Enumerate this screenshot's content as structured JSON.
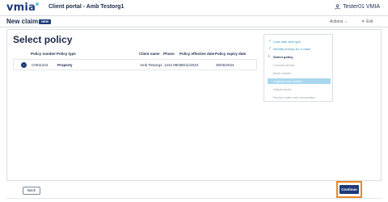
{
  "header": {
    "logo": "vmia",
    "portal_title": "Client portal - Amb Testorg1",
    "user_name": "Tester01 VMIA"
  },
  "subheader": {
    "claim_title": "New claim",
    "badge": "NEW",
    "actions_label": "Actions",
    "exit_label": "Exit"
  },
  "page": {
    "title": "Select policy"
  },
  "table": {
    "columns": [
      "Policy number",
      "Policy type",
      "Client name",
      "Phone",
      "Policy effective date",
      "Policy expiry date"
    ],
    "rows": [
      {
        "selected": true,
        "policy_number": "C0011224",
        "policy_type": "Property",
        "client_name": "Amb Testorg1",
        "phone": "1234 8901",
        "effective_date": "30/11/2023",
        "expiry_date": "30/06/2024"
      }
    ]
  },
  "steps": [
    {
      "label": "Loss date and type",
      "state": "done"
    },
    {
      "label": "Identify privacy for a claim",
      "state": "done"
    },
    {
      "label": "Select policy",
      "state": "current"
    },
    {
      "label": "Contact details",
      "state": "pending"
    },
    {
      "label": "Bank details",
      "state": "pending"
    },
    {
      "label": "Capture loss details",
      "state": "highlight"
    },
    {
      "label": "Attachments",
      "state": "pending"
    },
    {
      "label": "Review claim and declaration",
      "state": "pending"
    }
  ],
  "footer": {
    "back_label": "Back",
    "continue_label": "Continue"
  },
  "colors": {
    "brand": "#1d3a7a",
    "done": "#3a8fb8",
    "highlight": "#a9d7ee",
    "focus_outline": "#e8892a"
  }
}
